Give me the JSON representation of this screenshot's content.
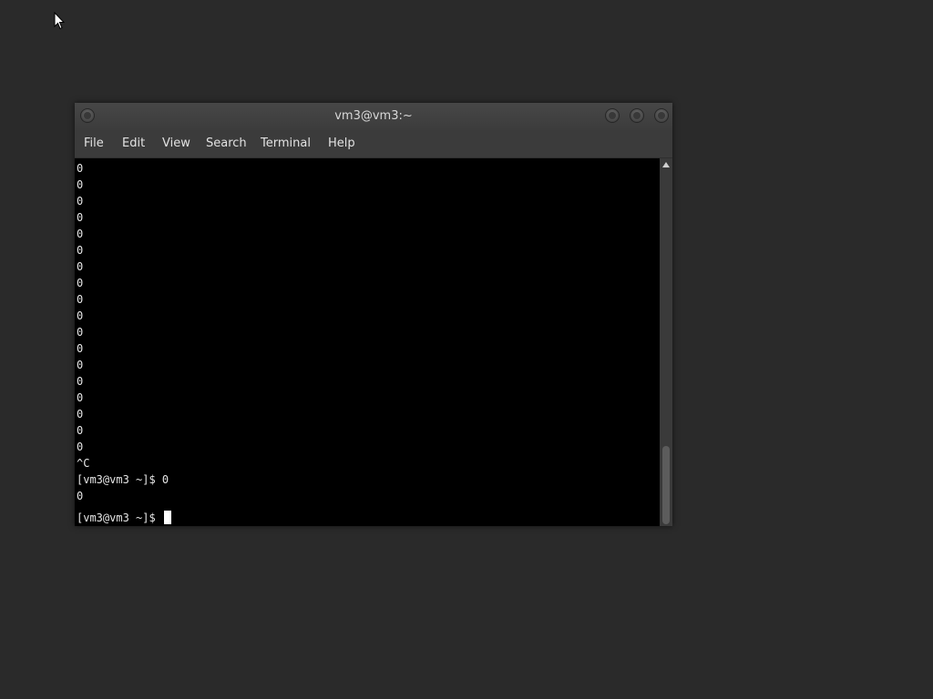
{
  "window": {
    "title": "vm3@vm3:~"
  },
  "menu": {
    "items": [
      "File",
      "Edit",
      "View",
      "Search",
      "Terminal",
      "Help"
    ]
  },
  "terminal": {
    "lines": [
      "0",
      "0",
      "0",
      "0",
      "0",
      "0",
      "0",
      "0",
      "0",
      "0",
      "0",
      "0",
      "0",
      "0",
      "0",
      "0",
      "0",
      "0",
      "^C",
      "[vm3@vm3 ~]$ 0",
      "0"
    ],
    "prompt": "[vm3@vm3 ~]$ "
  },
  "icons": {
    "pointer": "mouse-pointer-icon",
    "scroll_up": "arrow-up-icon",
    "window_buttons": [
      "minimize-icon",
      "maximize-icon",
      "close-icon"
    ],
    "menu_button": "window-menu-icon"
  },
  "colors": {
    "desktop_bg": "#2a2a2a",
    "window_bg": "#3b3b3b",
    "terminal_bg": "#000000",
    "terminal_fg": "#e6e6e6"
  }
}
